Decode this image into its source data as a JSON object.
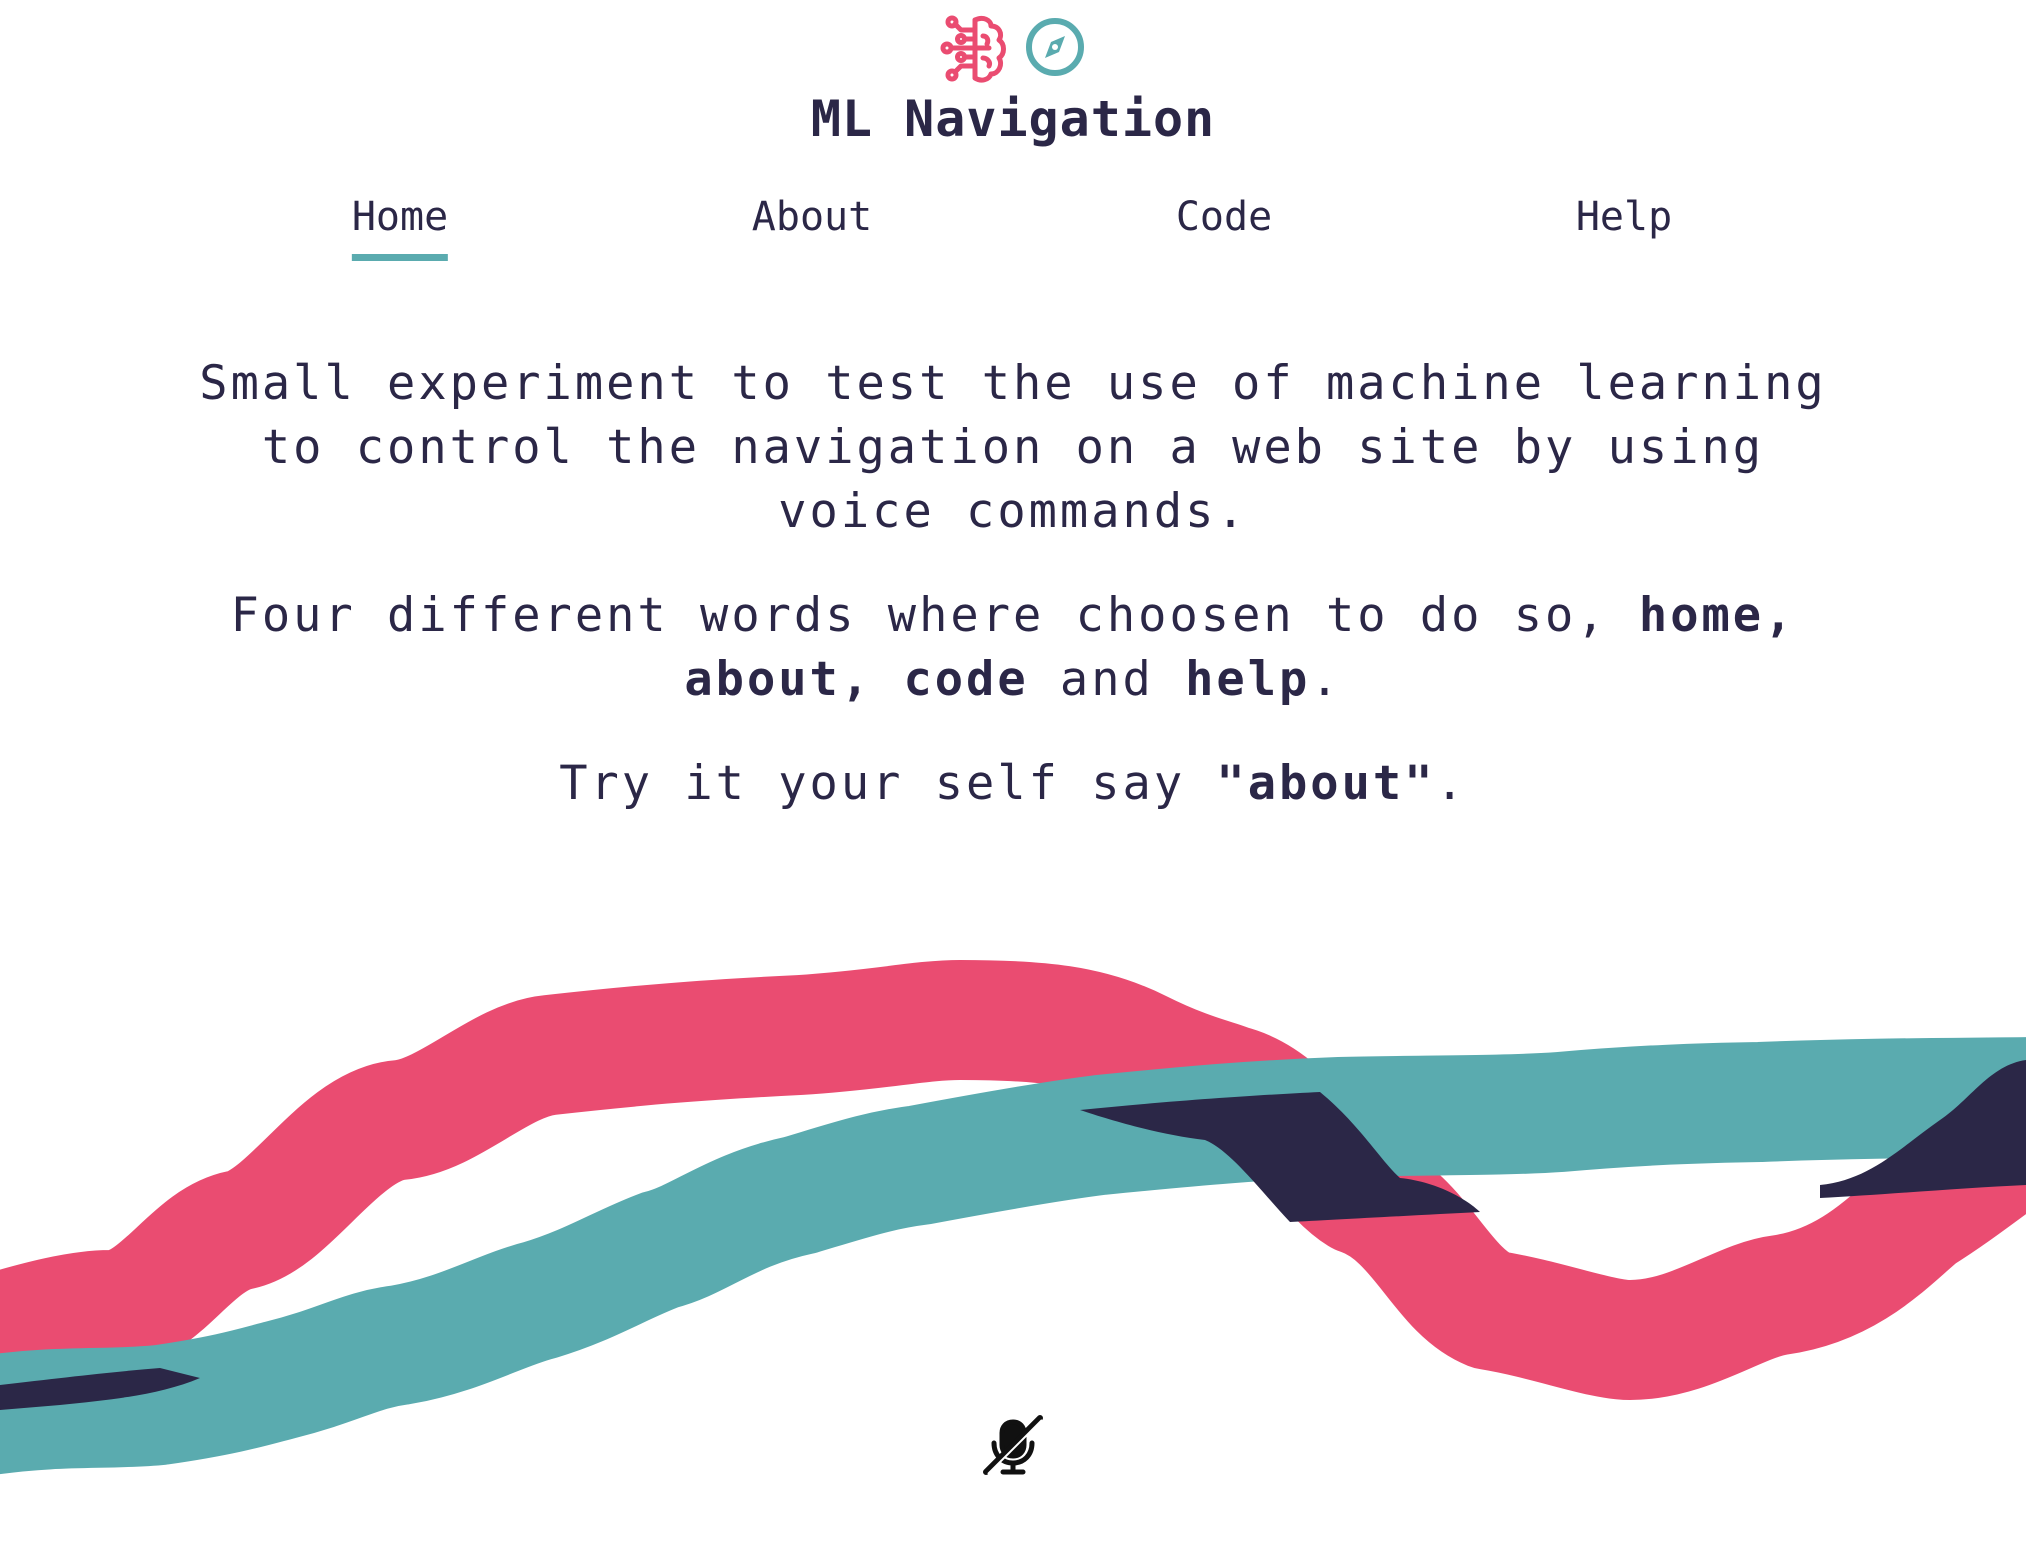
{
  "header": {
    "title": "ML Navigation",
    "icons": [
      "brain-circuit-icon",
      "compass-icon"
    ]
  },
  "nav": {
    "items": [
      {
        "label": "Home",
        "active": true
      },
      {
        "label": "About",
        "active": false
      },
      {
        "label": "Code",
        "active": false
      },
      {
        "label": "Help",
        "active": false
      }
    ]
  },
  "content": {
    "paragraph1": "Small experiment to test the use of machine learning to control the navigation on a web site by using voice commands.",
    "paragraph2": {
      "intro": "Four different words where choosen to do so, ",
      "word1": "home,",
      "word2": "about,",
      "word3": "code",
      "and": " and ",
      "word4": "help",
      "end": "."
    },
    "paragraph3": {
      "intro": "Try it your self say ",
      "command": "\"about\"",
      "end": "."
    }
  },
  "colors": {
    "pink": "#ea4c71",
    "teal": "#5aabaf",
    "dark": "#2b2747"
  },
  "controls": {
    "mic_icon": "microphone-off-icon"
  }
}
